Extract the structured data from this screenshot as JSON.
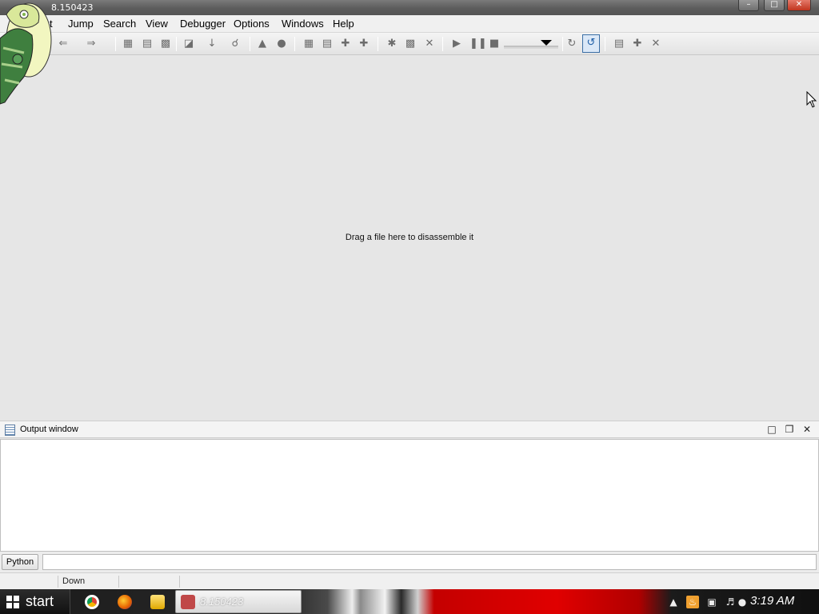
{
  "window": {
    "title": "8.150423",
    "controls": {
      "minimize": "–",
      "maximize": "□",
      "close": "✕"
    }
  },
  "menubar": {
    "items": [
      {
        "label": "t"
      },
      {
        "label": "Jump"
      },
      {
        "label": "Search"
      },
      {
        "label": "View"
      },
      {
        "label": "Debugger"
      },
      {
        "label": "Options"
      },
      {
        "label": "Windows"
      },
      {
        "label": "Help"
      }
    ]
  },
  "toolbar": {
    "icons": [
      "back-arrow-icon",
      "forward-arrow-icon",
      "hex-view-icon",
      "text-view-icon",
      "binary-view-icon",
      "open-icon",
      "down-arrow-icon",
      "search-icon",
      "graph-icon",
      "circle-icon",
      "add-code-icon",
      "add-data-icon",
      "add-string-icon",
      "add-struct-icon",
      "plugin-icon",
      "patch-icon",
      "delete-icon",
      "run-icon",
      "pause-icon",
      "stop-icon",
      "debugger-select-icon",
      "step-icon",
      "refresh-icon",
      "breakpoint-list-icon",
      "add-breakpoint-icon",
      "remove-breakpoint-icon"
    ],
    "debugger_value": ""
  },
  "main": {
    "hint": "Drag a file here to disassemble it"
  },
  "output_window": {
    "title": "Output window",
    "buttons": {
      "maximize": "□",
      "restore": "❐",
      "close": "✕"
    }
  },
  "python": {
    "button_label": "Python",
    "input_value": ""
  },
  "statusbar": {
    "state": "Down"
  },
  "taskbar": {
    "start_label": "start",
    "task_label": "8.150423",
    "clock": "3:19 AM",
    "tray_icons": [
      "show-hidden-icon",
      "java-icon",
      "network-icon",
      "volume-icon",
      "power-icon"
    ]
  },
  "colors": {
    "close_button": "#c0341e",
    "accent_border": "#3a6ea5",
    "workspace_bg": "#e6e6e6"
  }
}
